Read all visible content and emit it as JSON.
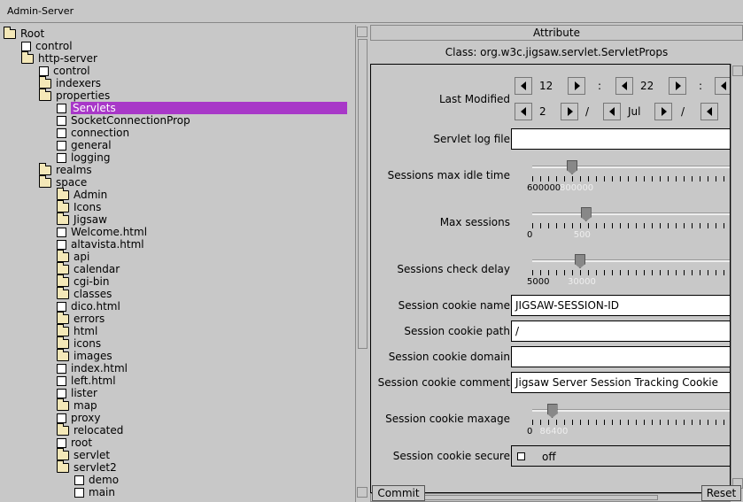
{
  "window": {
    "title": "Admin-Server"
  },
  "tree": {
    "items": [
      {
        "label": "Root",
        "type": "folder",
        "depth": 0
      },
      {
        "label": "control",
        "type": "file",
        "depth": 1
      },
      {
        "label": "http-server",
        "type": "folder",
        "depth": 1
      },
      {
        "label": "control",
        "type": "file",
        "depth": 2
      },
      {
        "label": "indexers",
        "type": "folder",
        "depth": 2
      },
      {
        "label": "properties",
        "type": "folder",
        "depth": 2
      },
      {
        "label": "Servlets",
        "type": "file",
        "depth": 3,
        "selected": true
      },
      {
        "label": "SocketConnectionProp",
        "type": "file",
        "depth": 3
      },
      {
        "label": "connection",
        "type": "file",
        "depth": 3
      },
      {
        "label": "general",
        "type": "file",
        "depth": 3
      },
      {
        "label": "logging",
        "type": "file",
        "depth": 3
      },
      {
        "label": "realms",
        "type": "folder",
        "depth": 2
      },
      {
        "label": "space",
        "type": "folder",
        "depth": 2
      },
      {
        "label": "Admin",
        "type": "folder",
        "depth": 3
      },
      {
        "label": "Icons",
        "type": "folder",
        "depth": 3
      },
      {
        "label": "Jigsaw",
        "type": "folder",
        "depth": 3
      },
      {
        "label": "Welcome.html",
        "type": "file",
        "depth": 3
      },
      {
        "label": "altavista.html",
        "type": "file",
        "depth": 3
      },
      {
        "label": "api",
        "type": "folder",
        "depth": 3
      },
      {
        "label": "calendar",
        "type": "folder",
        "depth": 3
      },
      {
        "label": "cgi-bin",
        "type": "folder",
        "depth": 3
      },
      {
        "label": "classes",
        "type": "folder",
        "depth": 3
      },
      {
        "label": "dico.html",
        "type": "file",
        "depth": 3
      },
      {
        "label": "errors",
        "type": "folder",
        "depth": 3
      },
      {
        "label": "html",
        "type": "folder",
        "depth": 3
      },
      {
        "label": "icons",
        "type": "folder",
        "depth": 3
      },
      {
        "label": "images",
        "type": "folder",
        "depth": 3
      },
      {
        "label": "index.html",
        "type": "file",
        "depth": 3
      },
      {
        "label": "left.html",
        "type": "file",
        "depth": 3
      },
      {
        "label": "lister",
        "type": "file",
        "depth": 3
      },
      {
        "label": "map",
        "type": "folder",
        "depth": 3
      },
      {
        "label": "proxy",
        "type": "file",
        "depth": 3
      },
      {
        "label": "relocated",
        "type": "folder",
        "depth": 3
      },
      {
        "label": "root",
        "type": "file",
        "depth": 3
      },
      {
        "label": "servlet",
        "type": "folder",
        "depth": 3
      },
      {
        "label": "servlet2",
        "type": "folder",
        "depth": 3
      },
      {
        "label": "demo",
        "type": "file",
        "depth": 4
      },
      {
        "label": "main",
        "type": "file",
        "depth": 4
      }
    ]
  },
  "attributes": {
    "header": "Attribute",
    "class_line": "Class: org.w3c.jigsaw.servlet.ServletProps",
    "last_modified": {
      "label": "Last Modified",
      "hour": "12",
      "minute": "22",
      "day": "2",
      "month": "Jul",
      "sep1": ":",
      "sep2": ":",
      "sep3": "/",
      "sep4": "/"
    },
    "servlet_log_file": {
      "label": "Servlet log file",
      "value": ""
    },
    "sessions_max_idle": {
      "label": "Sessions max idle time",
      "min": "600000",
      "value": "800000",
      "level": 0.2
    },
    "max_sessions": {
      "label": "Max sessions",
      "min": "0",
      "value": "500",
      "level": 0.27
    },
    "sessions_check_delay": {
      "label": "Sessions check delay",
      "min": "5000",
      "value": "30000",
      "level": 0.24
    },
    "cookie_name": {
      "label": "Session cookie name",
      "value": "JIGSAW-SESSION-ID"
    },
    "cookie_path": {
      "label": "Session cookie path",
      "value": "/"
    },
    "cookie_domain": {
      "label": "Session cookie domain",
      "value": ""
    },
    "cookie_comment": {
      "label": "Session cookie comment",
      "value": "Jigsaw Server Session Tracking Cookie"
    },
    "cookie_maxage": {
      "label": "Session cookie maxage",
      "min": "0",
      "value": "86400",
      "level": 0.1
    },
    "cookie_secure": {
      "label": "Session cookie secure",
      "value": "off"
    }
  },
  "buttons": {
    "commit": "Commit",
    "reset": "Reset"
  },
  "colors": {
    "selection": "#a838c8",
    "background": "#c8c8c8"
  }
}
